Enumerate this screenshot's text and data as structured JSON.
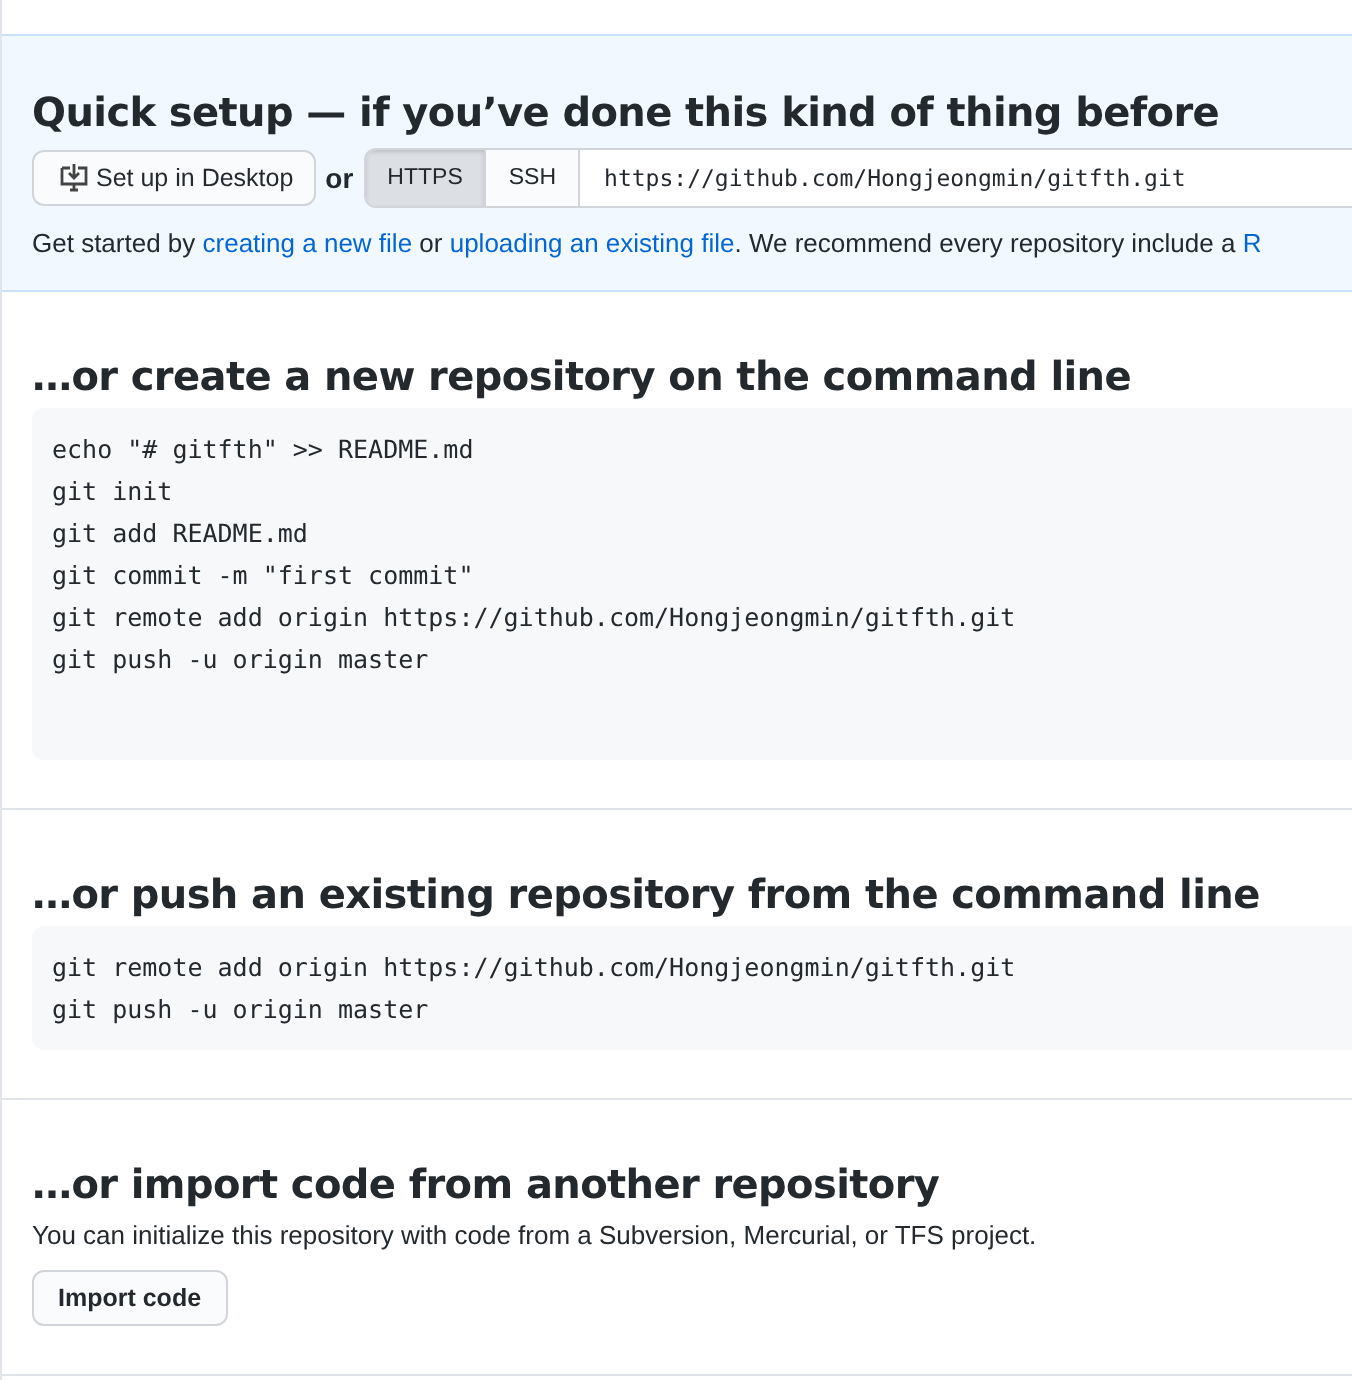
{
  "quick_setup": {
    "title": "Quick setup — if you’ve done this kind of thing before",
    "desktop_button": "Set up in Desktop",
    "or": "or",
    "protocols": [
      {
        "label": "HTTPS",
        "selected": true
      },
      {
        "label": "SSH",
        "selected": false
      }
    ],
    "url": "https://github.com/Hongjeongmin/gitfth.git",
    "help": [
      {
        "kind": "text",
        "text": "Get started by "
      },
      {
        "kind": "link",
        "text": "creating a new file"
      },
      {
        "kind": "text",
        "text": " or "
      },
      {
        "kind": "link",
        "text": "uploading an existing file"
      },
      {
        "kind": "text",
        "text": ". We recommend every repository include a "
      },
      {
        "kind": "link",
        "text": "R"
      }
    ]
  },
  "sections": [
    {
      "kind": "code",
      "title": "…or create a new repository on the command line",
      "code": [
        "echo \"# gitfth\" >> README.md",
        "git init",
        "git add README.md",
        "git commit -m \"first commit\"",
        "git remote add origin https://github.com/Hongjeongmin/gitfth.git",
        "git push -u origin master"
      ]
    },
    {
      "kind": "code",
      "title": "…or push an existing repository from the command line",
      "code": [
        "git remote add origin https://github.com/Hongjeongmin/gitfth.git",
        "git push -u origin master"
      ]
    },
    {
      "kind": "import",
      "title": "…or import code from another repository",
      "text": "You can initialize this repository with code from a Subversion, Mercurial, or TFS project.",
      "button": "Import code"
    }
  ]
}
